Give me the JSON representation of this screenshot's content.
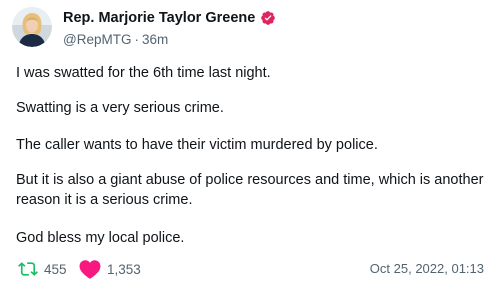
{
  "colors": {
    "text": "#0f1419",
    "muted": "#536471",
    "verified_badge": "#e0245e",
    "retweet": "#17bf63",
    "like": "#f91880"
  },
  "author": {
    "display_name": "Rep. Marjorie Taylor Greene",
    "verified_icon": "verified-badge-icon",
    "handle": "@RepMTG",
    "separator": "·",
    "time_ago": "36m"
  },
  "tweet": {
    "paragraphs": [
      "I was swatted for the 6th time last night.",
      "Swatting is a very serious crime.",
      "The caller wants to have their victim murdered by police.",
      "But it is also a giant abuse of police resources and time, which is another reason it is a serious crime.",
      "God bless my local police."
    ]
  },
  "stats": {
    "retweet_icon": "retweet-icon",
    "retweets": "455",
    "like_icon": "heart-icon",
    "likes": "1,353"
  },
  "timestamp": "Oct 25, 2022, 01:13"
}
